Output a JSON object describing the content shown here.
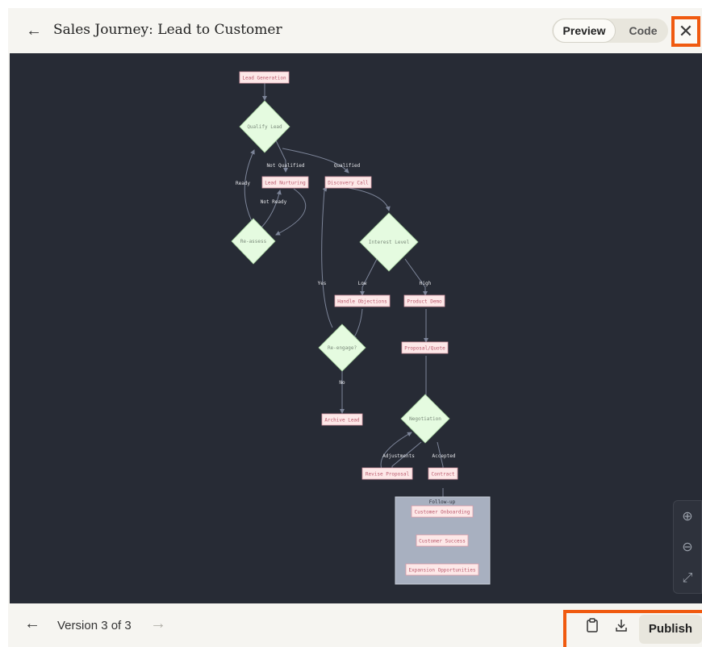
{
  "header": {
    "back_icon": "arrow-left-icon",
    "title": "Sales Journey: Lead to Customer",
    "toggle": {
      "preview_label": "Preview",
      "code_label": "Code",
      "selected": "Preview"
    },
    "close_icon": "close-icon"
  },
  "diagram": {
    "nodes": {
      "lead_generation": "Lead Generation",
      "qualify_lead": "Qualify Lead",
      "lead_nurturing": "Lead Nurturing",
      "discovery_call": "Discovery Call",
      "re_assess": "Re-assess",
      "interest_level": "Interest Level",
      "handle_objections": "Handle Objections",
      "product_demo": "Product Demo",
      "re_engage": "Re-engage?",
      "proposal_quote": "Proposal/Quote",
      "archive_lead": "Archive Lead",
      "negotiation": "Negotiation",
      "revise_proposal": "Revise Proposal",
      "contract": "Contract",
      "customer_onboarding": "Customer Onboarding",
      "customer_success": "Customer Success",
      "expansion_opportunities": "Expansion Opportunities"
    },
    "edges": {
      "not_qualified": "Not Qualified",
      "qualified": "Qualified",
      "ready": "Ready",
      "not_ready": "Not Ready",
      "yes": "Yes",
      "low": "Low",
      "high": "High",
      "no": "No",
      "adjustments": "Adjustments",
      "accepted": "Accepted"
    },
    "subgraph_label": "Follow-up"
  },
  "zoom": {
    "zoom_in_icon": "zoom-in-icon",
    "zoom_out_icon": "zoom-out-icon",
    "fit_icon": "expand-icon"
  },
  "footer": {
    "prev_icon": "arrow-left-icon",
    "version_label": "Version 3 of 3",
    "next_icon": "arrow-right-icon",
    "copy_icon": "clipboard-icon",
    "download_icon": "download-icon",
    "publish_label": "Publish"
  },
  "colors": {
    "accent_highlight": "#f05a10",
    "canvas_bg": "#272b35",
    "node_fill": "#fde8e8",
    "diamond_fill": "#e5fbe0"
  }
}
